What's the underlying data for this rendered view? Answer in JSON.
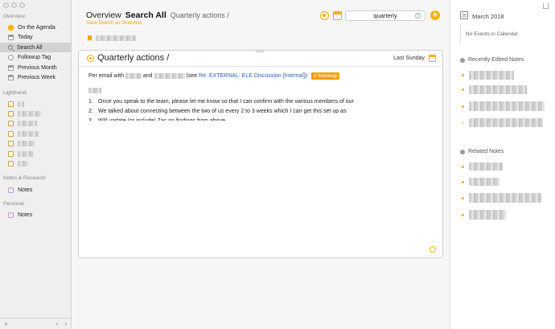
{
  "sidebar": {
    "sections": [
      {
        "label": "Overview",
        "items": [
          {
            "label": "On the Agenda",
            "icon": "sun-icon"
          },
          {
            "label": "Today",
            "icon": "calendar-icon"
          },
          {
            "label": "Search All",
            "icon": "search-icon",
            "active": true
          },
          {
            "label": "Followup Tag",
            "icon": "tag-icon"
          },
          {
            "label": "Previous Month",
            "icon": "calendar-icon"
          },
          {
            "label": "Previous Week",
            "icon": "calendar-icon"
          }
        ]
      },
      {
        "label": "Lighthand",
        "items_redacted": 8
      },
      {
        "label": "Notes & Research",
        "items": [
          {
            "label": "Notes",
            "icon": "notebook-icon"
          }
        ]
      },
      {
        "label": "Personal",
        "items": [
          {
            "label": "Notes",
            "icon": "notebook-icon"
          }
        ]
      }
    ],
    "add_symbol": "+",
    "back_symbol": "‹",
    "forward_symbol": "›"
  },
  "header": {
    "overview": "Overview",
    "search_all": "Search All",
    "query_title": "Quarterly actions /",
    "save_link": "Save Search as Overview"
  },
  "search": {
    "value": "quarterly",
    "clear_symbol": "×"
  },
  "add_button": "+",
  "note": {
    "title": "Quarterly actions /",
    "date": "Last Sunday",
    "body": {
      "prefix": "Per email with",
      "and": "and",
      "see_open": "(see",
      "link": "Re: EXTERNAL: ELE Discussion [Internal]",
      "see_close": "):",
      "tag": "# followup"
    },
    "list": [
      {
        "num": "1.",
        "text": "Once you speak to the team, please let me know so that I can confirm with the various members of our"
      },
      {
        "num": "2.",
        "text": "We talked about connecting between the two of us every 2 to 3 weeks which I can get this set up as"
      },
      {
        "num": "3.",
        "text": "Will update (or include) Zac on findings from above"
      }
    ]
  },
  "right_panel": {
    "calendar_day": "25",
    "month": "March 2018",
    "no_events": "No Events in Calendar",
    "recent_title": "Recently Edited Notes",
    "related_title": "Related Notes"
  }
}
